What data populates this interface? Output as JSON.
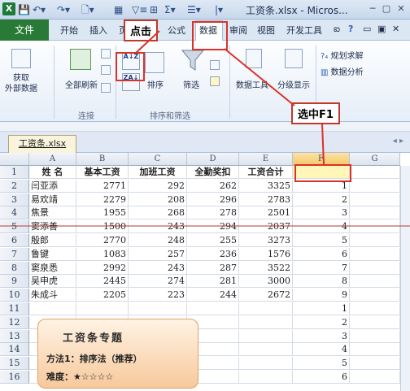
{
  "titlebar": {
    "logo": "X",
    "qa_icons": [
      "save-icon",
      "undo-icon",
      "redo-icon",
      "print-preview-icon",
      "table-icon",
      "filter-icon",
      "grid-icon",
      "sum-icon",
      "format-icon"
    ],
    "title": "工资条.xlsx - Micros...",
    "win_buttons": [
      "─",
      "▢",
      "✕"
    ]
  },
  "tabs": {
    "file": "文件",
    "items": [
      "开始",
      "插入",
      "页",
      "公式",
      "数据",
      "审阅",
      "视图",
      "开发工具"
    ],
    "help_icon": "help-icon"
  },
  "ribbon": {
    "get_external_data": "获取\n外部数据",
    "refresh_all": "全部刷新",
    "sort": "排序",
    "filter": "筛选",
    "data_tools": "数据工具",
    "outline": "分级显示",
    "solver": "规划求解",
    "data_analysis": "数据分析",
    "group_connections": "连接",
    "group_sort_filter": "排序和筛选",
    "sort_asc_text": "A↓Z",
    "sort_desc_text": "ZA↓"
  },
  "callouts": {
    "click": "点击",
    "select_f1": "选中F1"
  },
  "workbook_tab": "工资条.xlsx",
  "sheet": {
    "columns": [
      "A",
      "B",
      "C",
      "D",
      "E",
      "F",
      "G"
    ],
    "rows": [
      "1",
      "2",
      "3",
      "4",
      "5",
      "6",
      "7",
      "8",
      "9",
      "10",
      "11",
      "12",
      "13",
      "14",
      "15",
      "16"
    ],
    "header": [
      "姓 名",
      "基本工资",
      "加班工资",
      "全勤奖扣",
      "工资合计",
      ""
    ],
    "data": [
      [
        "闫亚添",
        "2771",
        "292",
        "262",
        "3325",
        "1"
      ],
      [
        "易欢靖",
        "2279",
        "208",
        "296",
        "2783",
        "2"
      ],
      [
        "焦景",
        "1955",
        "268",
        "278",
        "2501",
        "3"
      ],
      [
        "窦添善",
        "1500",
        "243",
        "294",
        "2037",
        "4"
      ],
      [
        "殷郎",
        "2770",
        "248",
        "255",
        "3273",
        "5"
      ],
      [
        "鲁键",
        "1083",
        "257",
        "236",
        "1576",
        "6"
      ],
      [
        "窦泉悉",
        "2992",
        "243",
        "287",
        "3522",
        "7"
      ],
      [
        "吴申虎",
        "2445",
        "274",
        "281",
        "3000",
        "8"
      ],
      [
        "朱成斗",
        "2205",
        "223",
        "244",
        "2672",
        "9"
      ]
    ],
    "f_extra": [
      "1",
      "2",
      "3",
      "4",
      "5",
      "6"
    ]
  },
  "info_box": {
    "title": "工资条专题",
    "method": "方法1：排序法（推荐）",
    "difficulty": "难度：★☆☆☆☆"
  }
}
